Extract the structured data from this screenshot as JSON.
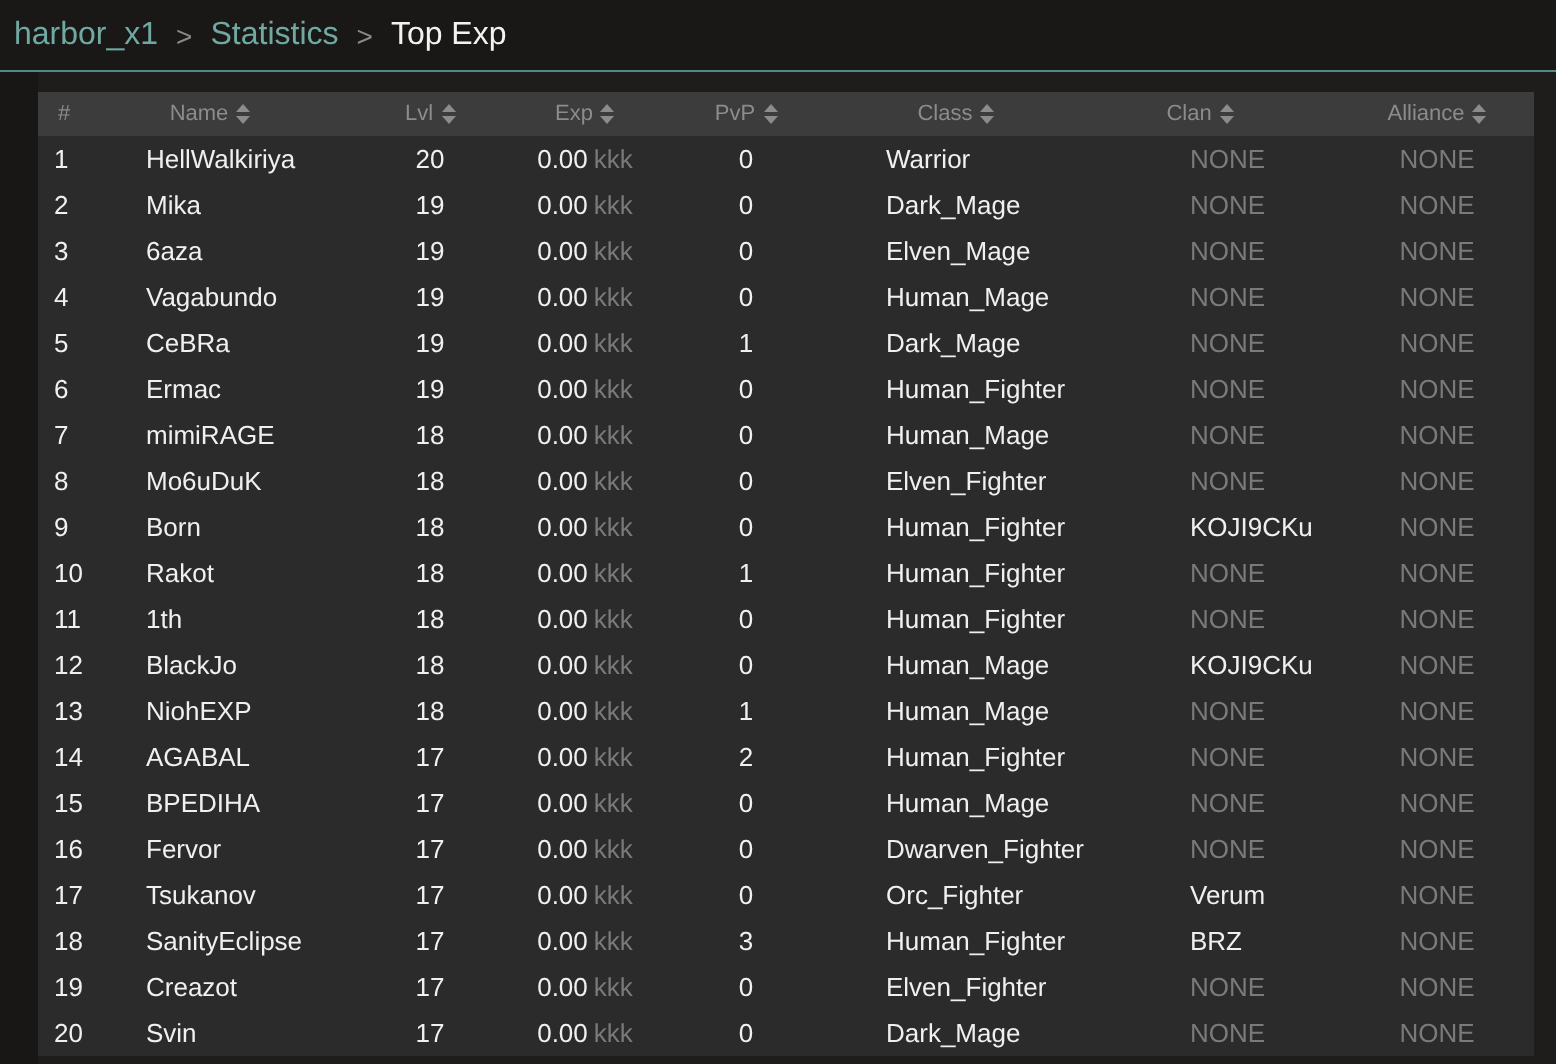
{
  "breadcrumb": [
    {
      "label": "harbor_x1",
      "current": false
    },
    {
      "label": "Statistics",
      "current": false
    },
    {
      "label": "Top Exp",
      "current": true
    }
  ],
  "breadcrumb_separator": ">",
  "table": {
    "columns": [
      {
        "label": "#",
        "sortable": false
      },
      {
        "label": "Name",
        "sortable": true
      },
      {
        "label": "Lvl",
        "sortable": true
      },
      {
        "label": "Exp",
        "sortable": true
      },
      {
        "label": "PvP",
        "sortable": true
      },
      {
        "label": "Class",
        "sortable": true
      },
      {
        "label": "Clan",
        "sortable": true
      },
      {
        "label": "Alliance",
        "sortable": true
      }
    ],
    "rows": [
      {
        "rank": "1",
        "name": "HellWalkiriya",
        "lvl": "20",
        "exp": "0.00",
        "exp_unit": "kkk",
        "pvp": "0",
        "class": "Warrior",
        "clan": {
          "text": "NONE",
          "empty": true
        },
        "alliance": {
          "text": "NONE",
          "empty": true
        }
      },
      {
        "rank": "2",
        "name": "Mika",
        "lvl": "19",
        "exp": "0.00",
        "exp_unit": "kkk",
        "pvp": "0",
        "class": "Dark_Mage",
        "clan": {
          "text": "NONE",
          "empty": true
        },
        "alliance": {
          "text": "NONE",
          "empty": true
        }
      },
      {
        "rank": "3",
        "name": "6aza",
        "lvl": "19",
        "exp": "0.00",
        "exp_unit": "kkk",
        "pvp": "0",
        "class": "Elven_Mage",
        "clan": {
          "text": "NONE",
          "empty": true
        },
        "alliance": {
          "text": "NONE",
          "empty": true
        }
      },
      {
        "rank": "4",
        "name": "Vagabundo",
        "lvl": "19",
        "exp": "0.00",
        "exp_unit": "kkk",
        "pvp": "0",
        "class": "Human_Mage",
        "clan": {
          "text": "NONE",
          "empty": true
        },
        "alliance": {
          "text": "NONE",
          "empty": true
        }
      },
      {
        "rank": "5",
        "name": "CeBRa",
        "lvl": "19",
        "exp": "0.00",
        "exp_unit": "kkk",
        "pvp": "1",
        "class": "Dark_Mage",
        "clan": {
          "text": "NONE",
          "empty": true
        },
        "alliance": {
          "text": "NONE",
          "empty": true
        }
      },
      {
        "rank": "6",
        "name": "Ermac",
        "lvl": "19",
        "exp": "0.00",
        "exp_unit": "kkk",
        "pvp": "0",
        "class": "Human_Fighter",
        "clan": {
          "text": "NONE",
          "empty": true
        },
        "alliance": {
          "text": "NONE",
          "empty": true
        }
      },
      {
        "rank": "7",
        "name": "mimiRAGE",
        "lvl": "18",
        "exp": "0.00",
        "exp_unit": "kkk",
        "pvp": "0",
        "class": "Human_Mage",
        "clan": {
          "text": "NONE",
          "empty": true
        },
        "alliance": {
          "text": "NONE",
          "empty": true
        }
      },
      {
        "rank": "8",
        "name": "Mo6uDuK",
        "lvl": "18",
        "exp": "0.00",
        "exp_unit": "kkk",
        "pvp": "0",
        "class": "Elven_Fighter",
        "clan": {
          "text": "NONE",
          "empty": true
        },
        "alliance": {
          "text": "NONE",
          "empty": true
        }
      },
      {
        "rank": "9",
        "name": "Born",
        "lvl": "18",
        "exp": "0.00",
        "exp_unit": "kkk",
        "pvp": "0",
        "class": "Human_Fighter",
        "clan": {
          "text": "KOJI9CKu",
          "empty": false
        },
        "alliance": {
          "text": "NONE",
          "empty": true
        }
      },
      {
        "rank": "10",
        "name": "Rakot",
        "lvl": "18",
        "exp": "0.00",
        "exp_unit": "kkk",
        "pvp": "1",
        "class": "Human_Fighter",
        "clan": {
          "text": "NONE",
          "empty": true
        },
        "alliance": {
          "text": "NONE",
          "empty": true
        }
      },
      {
        "rank": "11",
        "name": "1th",
        "lvl": "18",
        "exp": "0.00",
        "exp_unit": "kkk",
        "pvp": "0",
        "class": "Human_Fighter",
        "clan": {
          "text": "NONE",
          "empty": true
        },
        "alliance": {
          "text": "NONE",
          "empty": true
        }
      },
      {
        "rank": "12",
        "name": "BlackJo",
        "lvl": "18",
        "exp": "0.00",
        "exp_unit": "kkk",
        "pvp": "0",
        "class": "Human_Mage",
        "clan": {
          "text": "KOJI9CKu",
          "empty": false
        },
        "alliance": {
          "text": "NONE",
          "empty": true
        }
      },
      {
        "rank": "13",
        "name": "NiohEXP",
        "lvl": "18",
        "exp": "0.00",
        "exp_unit": "kkk",
        "pvp": "1",
        "class": "Human_Mage",
        "clan": {
          "text": "NONE",
          "empty": true
        },
        "alliance": {
          "text": "NONE",
          "empty": true
        }
      },
      {
        "rank": "14",
        "name": "AGABAL",
        "lvl": "17",
        "exp": "0.00",
        "exp_unit": "kkk",
        "pvp": "2",
        "class": "Human_Fighter",
        "clan": {
          "text": "NONE",
          "empty": true
        },
        "alliance": {
          "text": "NONE",
          "empty": true
        }
      },
      {
        "rank": "15",
        "name": "BPEDIHA",
        "lvl": "17",
        "exp": "0.00",
        "exp_unit": "kkk",
        "pvp": "0",
        "class": "Human_Mage",
        "clan": {
          "text": "NONE",
          "empty": true
        },
        "alliance": {
          "text": "NONE",
          "empty": true
        }
      },
      {
        "rank": "16",
        "name": "Fervor",
        "lvl": "17",
        "exp": "0.00",
        "exp_unit": "kkk",
        "pvp": "0",
        "class": "Dwarven_Fighter",
        "clan": {
          "text": "NONE",
          "empty": true
        },
        "alliance": {
          "text": "NONE",
          "empty": true
        }
      },
      {
        "rank": "17",
        "name": "Tsukanov",
        "lvl": "17",
        "exp": "0.00",
        "exp_unit": "kkk",
        "pvp": "0",
        "class": "Orc_Fighter",
        "clan": {
          "text": "Verum",
          "empty": false
        },
        "alliance": {
          "text": "NONE",
          "empty": true
        }
      },
      {
        "rank": "18",
        "name": "SanityEclipse",
        "lvl": "17",
        "exp": "0.00",
        "exp_unit": "kkk",
        "pvp": "3",
        "class": "Human_Fighter",
        "clan": {
          "text": "BRZ",
          "empty": false
        },
        "alliance": {
          "text": "NONE",
          "empty": true
        }
      },
      {
        "rank": "19",
        "name": "Creazot",
        "lvl": "17",
        "exp": "0.00",
        "exp_unit": "kkk",
        "pvp": "0",
        "class": "Elven_Fighter",
        "clan": {
          "text": "NONE",
          "empty": true
        },
        "alliance": {
          "text": "NONE",
          "empty": true
        }
      },
      {
        "rank": "20",
        "name": "Svin",
        "lvl": "17",
        "exp": "0.00",
        "exp_unit": "kkk",
        "pvp": "0",
        "class": "Dark_Mage",
        "clan": {
          "text": "NONE",
          "empty": true
        },
        "alliance": {
          "text": "NONE",
          "empty": true
        }
      }
    ]
  }
}
